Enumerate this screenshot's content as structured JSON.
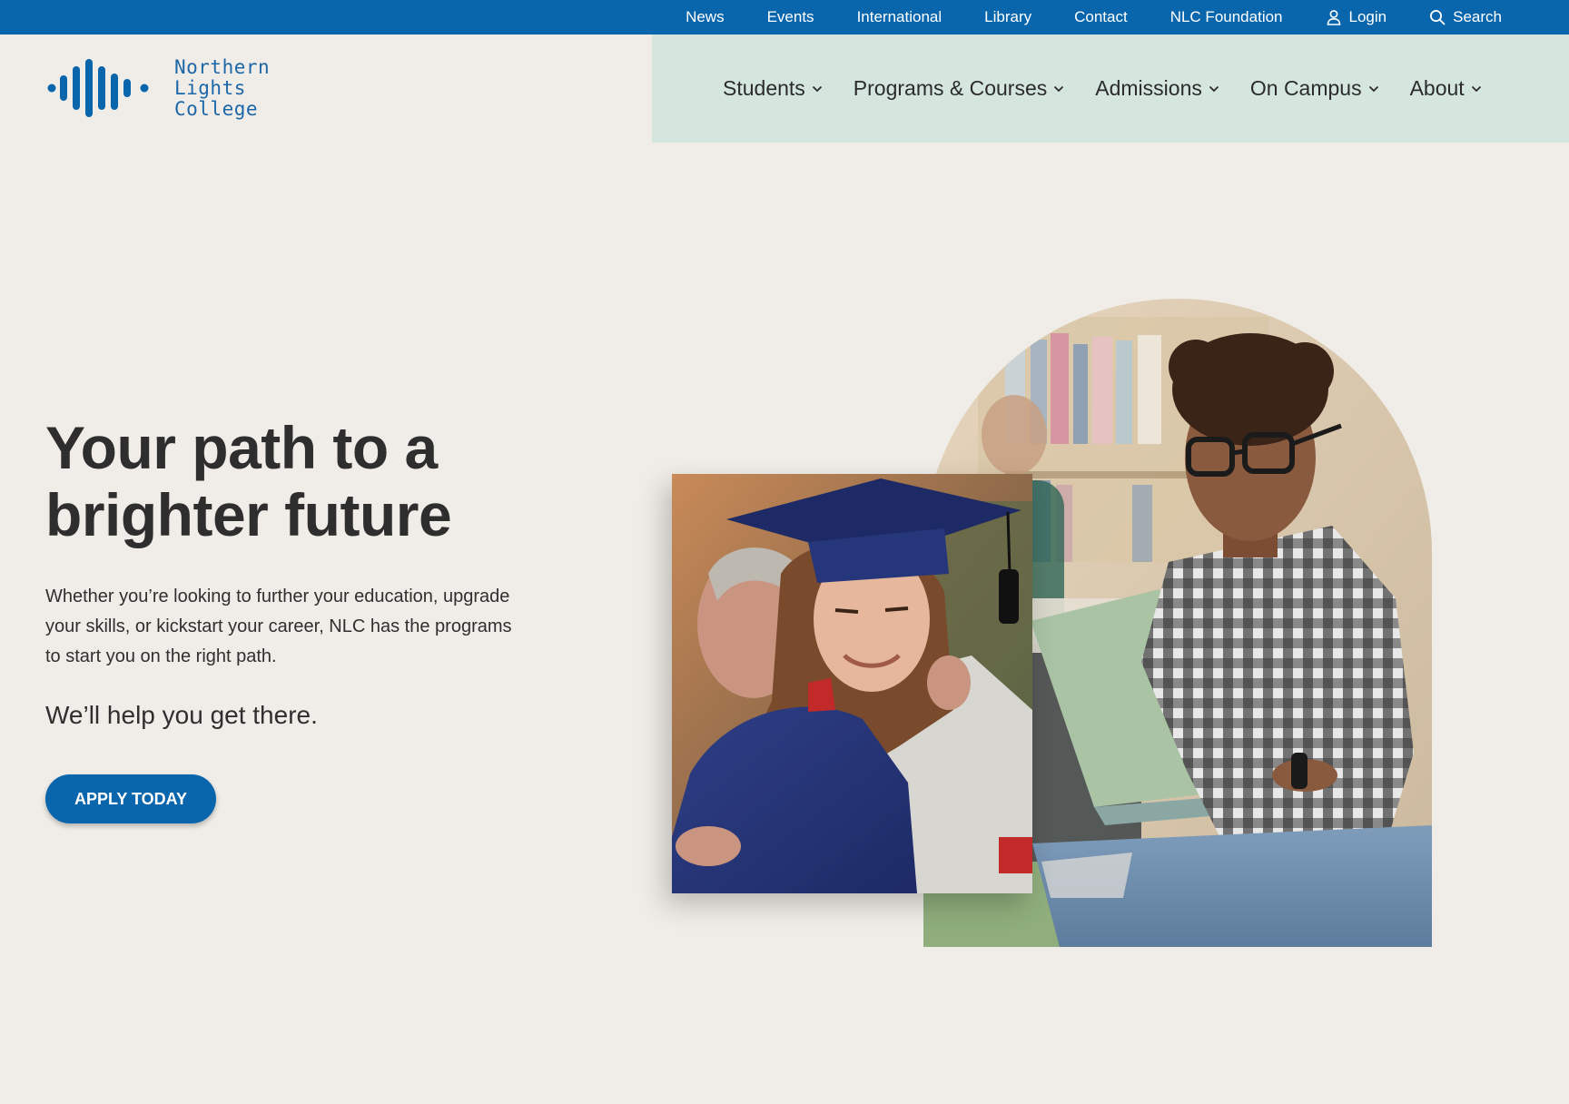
{
  "utility_nav": {
    "items": [
      {
        "label": "News"
      },
      {
        "label": "Events"
      },
      {
        "label": "International"
      },
      {
        "label": "Library"
      },
      {
        "label": "Contact"
      },
      {
        "label": "NLC Foundation"
      }
    ],
    "login": {
      "label": "Login",
      "icon": "user-icon"
    },
    "search": {
      "label": "Search",
      "icon": "search-icon"
    }
  },
  "logo": {
    "line1": "Northern Lights",
    "line2": "College"
  },
  "main_nav": {
    "items": [
      {
        "label": "Students"
      },
      {
        "label": "Programs & Courses"
      },
      {
        "label": "Admissions"
      },
      {
        "label": "On Campus"
      },
      {
        "label": "About"
      }
    ]
  },
  "hero": {
    "title_line1": "Your path to a",
    "title_line2": "brighter future",
    "body": "Whether you’re looking to further your education, upgrade your skills, or kickstart your career, NLC has the programs to start you on the right path.",
    "tagline": "We’ll help you get there.",
    "cta_label": "APPLY TODAY"
  },
  "colors": {
    "brand_blue": "#0966ad",
    "nav_mint": "#d5e6df",
    "page_bg": "#f0ede8"
  }
}
